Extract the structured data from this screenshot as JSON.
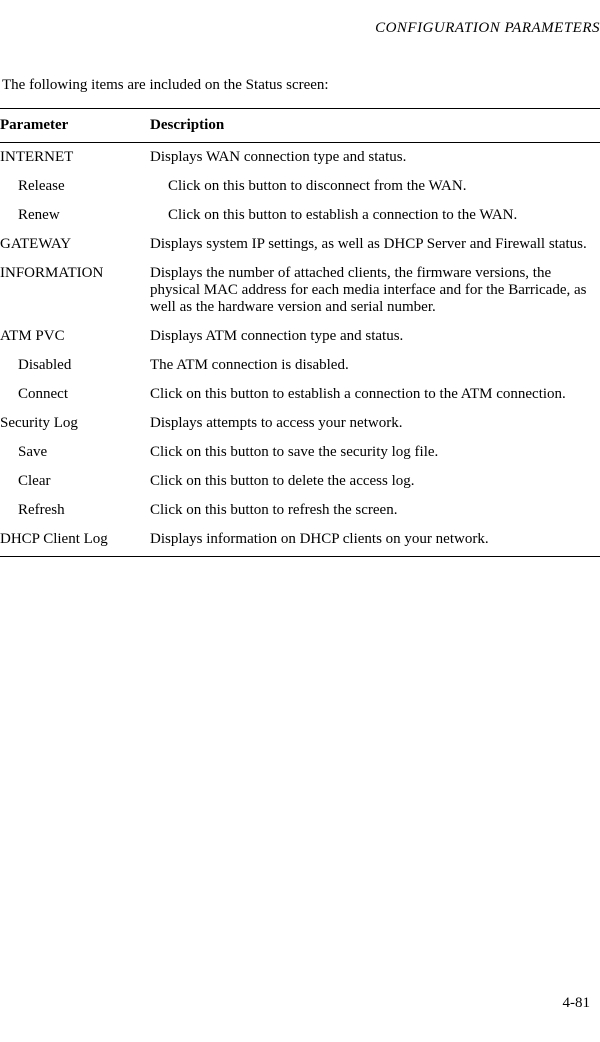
{
  "header": {
    "title": "CONFIGURATION PARAMETERS"
  },
  "intro": "The following items are included on the Status screen:",
  "table": {
    "headers": {
      "parameter": "Parameter",
      "description": "Description"
    },
    "rows": [
      {
        "param": "INTERNET",
        "desc": "Displays WAN connection type and status.",
        "indent": false,
        "descIndent": false
      },
      {
        "param": "Release",
        "desc": "Click on this button to disconnect from the WAN.",
        "indent": true,
        "descIndent": true
      },
      {
        "param": "Renew",
        "desc": "Click on this button to establish a connection to the WAN.",
        "indent": true,
        "descIndent": true
      },
      {
        "param": "GATEWAY",
        "desc": "Displays system IP settings, as well as DHCP Server and Firewall status.",
        "indent": false,
        "descIndent": false
      },
      {
        "param": "INFORMATION",
        "desc": "Displays the number of attached clients, the firmware versions, the physical MAC address for each media interface and for the Barricade, as well as the hardware version and serial number.",
        "indent": false,
        "descIndent": false
      },
      {
        "param": "ATM PVC",
        "desc": "Displays ATM connection type and status.",
        "indent": false,
        "descIndent": false
      },
      {
        "param": "Disabled",
        "desc": "The ATM connection is disabled.",
        "indent": true,
        "descIndent": false
      },
      {
        "param": "Connect",
        "desc": "Click on this button to establish a connection to the ATM connection.",
        "indent": true,
        "descIndent": false
      },
      {
        "param": "Security Log",
        "desc": "Displays attempts to access your network.",
        "indent": false,
        "descIndent": false
      },
      {
        "param": "Save",
        "desc": "Click on this button to save the security log file.",
        "indent": true,
        "descIndent": false
      },
      {
        "param": "Clear",
        "desc": "Click on this button to delete the access log.",
        "indent": true,
        "descIndent": false
      },
      {
        "param": "Refresh",
        "desc": "Click on this button to refresh the screen.",
        "indent": true,
        "descIndent": false
      },
      {
        "param": "DHCP Client Log",
        "desc": "Displays information on DHCP clients on your network.",
        "indent": false,
        "descIndent": false,
        "last": true
      }
    ]
  },
  "footer": {
    "pageNumber": "4-81"
  }
}
